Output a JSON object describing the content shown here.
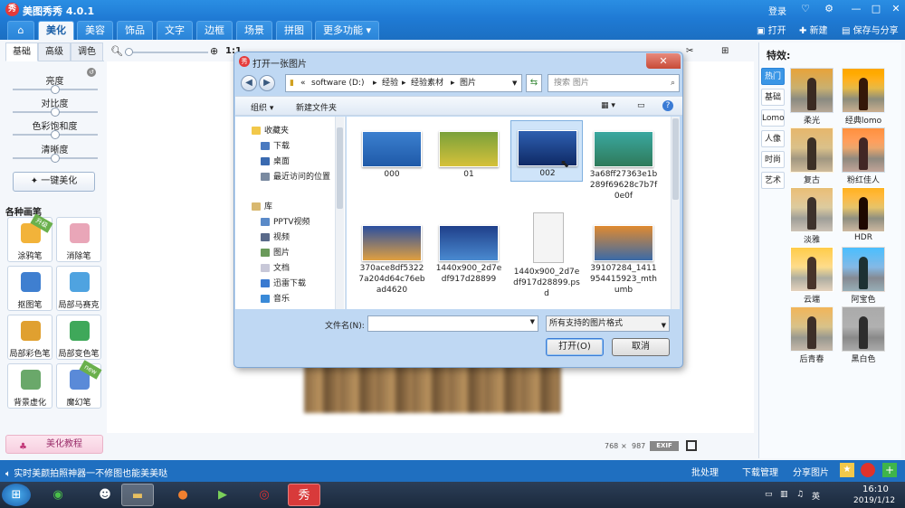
{
  "app": {
    "title": "美图秀秀 4.0.1",
    "logo_text": "秀",
    "login": "登录",
    "window_controls": [
      "♡",
      "—",
      "□",
      "✕"
    ]
  },
  "menu": {
    "home_icon": "home-icon",
    "tabs": [
      "美化",
      "美容",
      "饰品",
      "文字",
      "边框",
      "场景",
      "拼图",
      "更多功能 ▾"
    ],
    "active_tab": "美化",
    "right": {
      "open": "打开",
      "new": "新建",
      "save": "保存与分享"
    }
  },
  "left_panel": {
    "subtabs": [
      "基础",
      "高级",
      "调色"
    ],
    "sliders": [
      {
        "label": "亮度",
        "value": 0.5
      },
      {
        "label": "对比度",
        "value": 0.5
      },
      {
        "label": "色彩饱和度",
        "value": 0.5
      },
      {
        "label": "清晰度",
        "value": 0.5
      }
    ],
    "one_key_button": "一键美化",
    "brushes_title": "各种画笔",
    "tools": [
      {
        "label": "涂鸦笔",
        "badge": "升级",
        "color": "#f2b33a"
      },
      {
        "label": "消除笔",
        "badge": "",
        "color": "#e9a6b8"
      },
      {
        "label": "抠图笔",
        "badge": "",
        "color": "#3f7fd0"
      },
      {
        "label": "局部马赛克",
        "badge": "",
        "color": "#4fa3e0"
      },
      {
        "label": "局部彩色笔",
        "badge": "",
        "color": "#e0a030"
      },
      {
        "label": "局部变色笔",
        "badge": "",
        "color": "#3fa85a"
      },
      {
        "label": "背景虚化",
        "badge": "",
        "color": "#6aa86a"
      },
      {
        "label": "魔幻笔",
        "badge": "new",
        "color": "#5a8ad8"
      }
    ],
    "tutorial": "美化教程"
  },
  "toolbar": {
    "zoom_label": "1:1"
  },
  "canvas": {
    "size_w": "768",
    "size_h": "987",
    "exif": "EXIF"
  },
  "right_panel": {
    "title": "特效:",
    "categories": [
      "热门",
      "基础",
      "Lomo",
      "人像",
      "时尚",
      "艺术"
    ],
    "active_category": "热门",
    "effects": [
      "柔光",
      "经典lomo",
      "复古",
      "粉红佳人",
      "淡雅",
      "HDR",
      "云端",
      "阿宝色",
      "后青春",
      "黑白色"
    ]
  },
  "bottom_bar": {
    "message": "实时美颜拍照神器一不修图也能美美哒",
    "batch": "批处理",
    "download": "下载管理",
    "share": "分享图片"
  },
  "taskbar": {
    "time": "16:10",
    "date": "2019/1/12",
    "tray_icons": [
      "battery-icon",
      "network-icon",
      "volume-icon",
      "input-method-icon"
    ]
  },
  "dialog": {
    "title": "打开一张图片",
    "logo_text": "秀",
    "close": "✕",
    "path": [
      "software (D:)",
      "经验",
      "经验素材",
      "图片"
    ],
    "path_prefix": "«",
    "search_placeholder": "搜索 图片",
    "organize": "组织 ▾",
    "new_folder": "新建文件夹",
    "nav": {
      "favorites": "收藏夹",
      "fav_items": [
        "下载",
        "桌面",
        "最近访问的位置"
      ],
      "library": "库",
      "lib_items": [
        "PPTV视频",
        "视频",
        "图片",
        "文档",
        "迅雷下载",
        "音乐"
      ]
    },
    "files": [
      {
        "name": "000",
        "thumb": "linear-gradient(#3b7fcf,#1f5aa8)"
      },
      {
        "name": "01",
        "thumb": "linear-gradient(#7aa13a,#d6c13a)"
      },
      {
        "name": "002",
        "thumb": "linear-gradient(#2e5fb0,#0f2a66)"
      },
      {
        "name": "3a68ff27363e1b289f69628c7b7f0e0f",
        "thumb": "linear-gradient(#3aa8a0,#2f7a5a)"
      },
      {
        "name": "370ace8df53227a204d64c76ebad4620",
        "thumb": "linear-gradient(#2a4fa0,#e0a040)"
      },
      {
        "name": "1440x900_2d7edf917d28899",
        "thumb": "linear-gradient(#1f3f8a,#4a8ad0)"
      },
      {
        "name": "1440x900_2d7edf917d28899.psd",
        "thumb": "psd"
      },
      {
        "name": "39107284_1411954415923_mthumb",
        "thumb": "linear-gradient(#e08a30,#3a6aa8)"
      }
    ],
    "selected_file": "002",
    "filename_label": "文件名(N):",
    "filename_value": "",
    "filter": "所有支持的图片格式",
    "open_button": "打开(O)",
    "cancel_button": "取消"
  }
}
